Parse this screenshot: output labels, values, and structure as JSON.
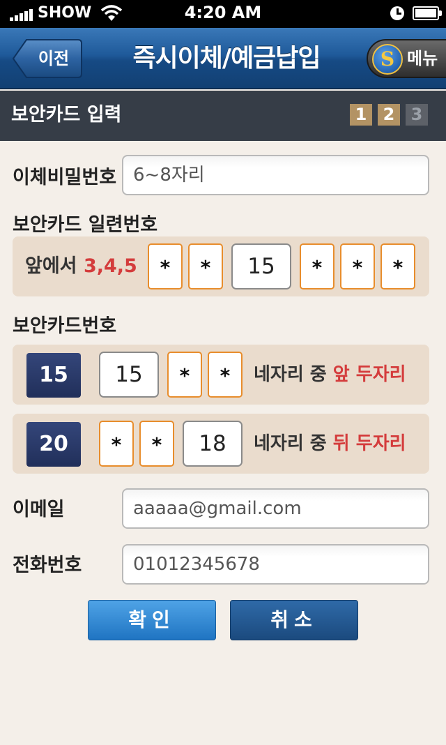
{
  "status_bar": {
    "carrier": "SHOW",
    "time": "4:20 AM",
    "signal_icon": "signal-bars-icon",
    "wifi_icon": "wifi-icon",
    "lock_icon": "rotation-lock-icon",
    "battery_icon": "battery-icon"
  },
  "nav": {
    "back_label": "이전",
    "title": "즉시이체/예금납입",
    "menu_label": "메뉴",
    "menu_logo_icon": "bank-logo-icon"
  },
  "section": {
    "title": "보안카드 입력",
    "steps": [
      "1",
      "2",
      "3"
    ],
    "current_step": 2
  },
  "form": {
    "transfer_password": {
      "label": "이체비밀번호",
      "placeholder": "6~8자리",
      "value": ""
    },
    "serial": {
      "label": "보안카드 일련번호",
      "prefix": "앞에서",
      "positions": "3,4,5",
      "cells": [
        "*",
        "*",
        "15",
        "*",
        "*",
        "*"
      ]
    },
    "card_number": {
      "label": "보안카드번호",
      "rows": [
        {
          "index": "15",
          "cells": [
            "15",
            "*",
            "*"
          ],
          "desc_prefix": "네자리 중",
          "desc_highlight": "앞 두자리"
        },
        {
          "index": "20",
          "cells": [
            "*",
            "*",
            "18"
          ],
          "desc_prefix": "네자리 중",
          "desc_highlight": "뒤 두자리"
        }
      ]
    },
    "email": {
      "label": "이메일",
      "value": "aaaaa@gmail.com"
    },
    "phone": {
      "label": "전화번호",
      "value": "01012345678"
    }
  },
  "buttons": {
    "confirm": "확인",
    "cancel": "취소"
  },
  "colors": {
    "highlight_red": "#d43c3c",
    "accent_orange": "#e88d2c",
    "nav_blue": "#1f5a9a"
  }
}
